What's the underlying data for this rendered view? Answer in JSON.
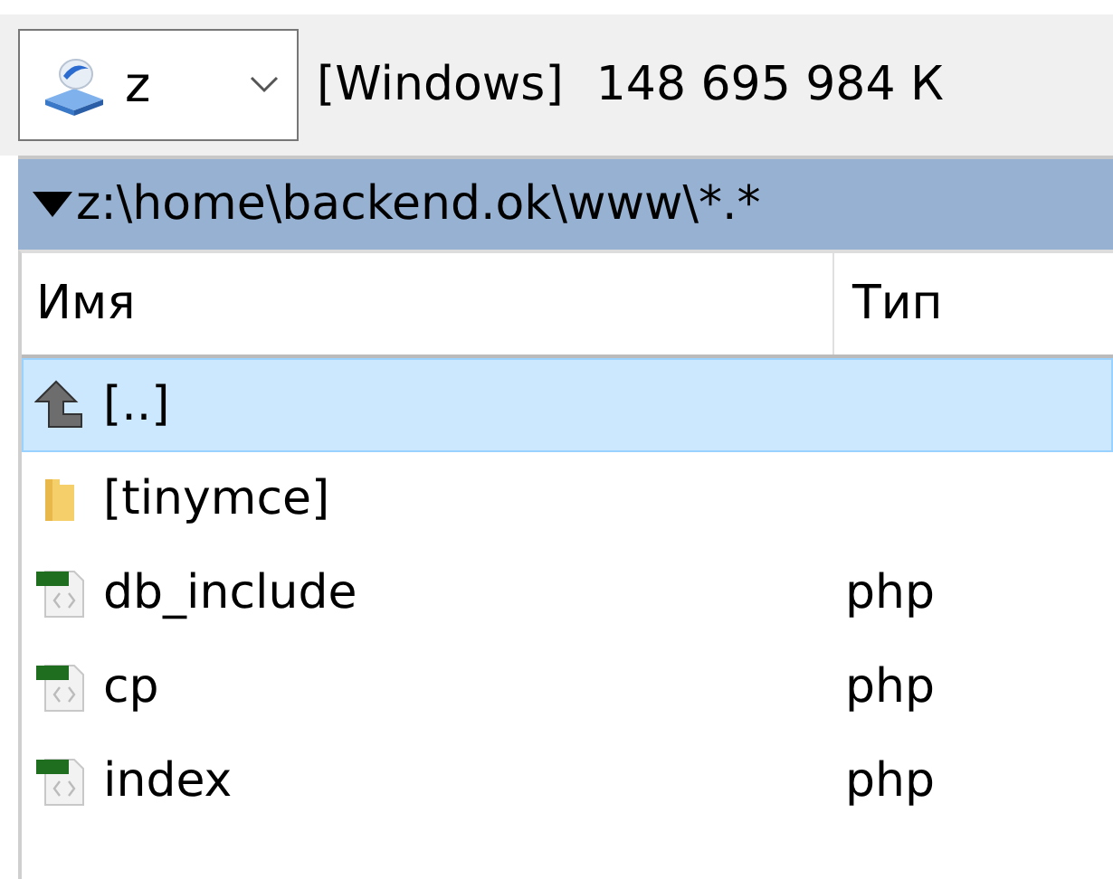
{
  "drive": {
    "letter": "z"
  },
  "volume": {
    "label": "[Windows]",
    "free": "148 695 984 К"
  },
  "path": "z:\\home\\backend.ok\\www\\*.*",
  "columns": [
    "Имя",
    "Тип"
  ],
  "rows": [
    {
      "kind": "up",
      "name": "[..]",
      "selected": true
    },
    {
      "kind": "folder",
      "name": "[tinymce]",
      "selected": false
    },
    {
      "kind": "file",
      "name": "db_include",
      "type": "php",
      "selected": false
    },
    {
      "kind": "file",
      "name": "cp",
      "type": "php",
      "selected": false
    },
    {
      "kind": "file",
      "name": "index",
      "type": "php",
      "selected": false
    }
  ]
}
